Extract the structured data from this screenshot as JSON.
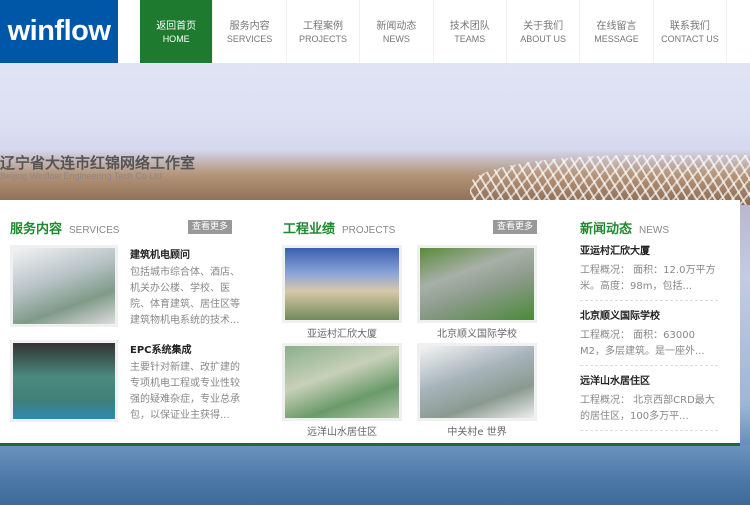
{
  "header": {
    "logo": "winflow",
    "nav": [
      {
        "cn": "返回首页",
        "en": "HOME",
        "active": true
      },
      {
        "cn": "服务内容",
        "en": "SERVICES"
      },
      {
        "cn": "工程案例",
        "en": "PROJECTS"
      },
      {
        "cn": "新闻动态",
        "en": "NEWS"
      },
      {
        "cn": "技术团队",
        "en": "TEAMS"
      },
      {
        "cn": "关于我们",
        "en": "ABOUT US"
      },
      {
        "cn": "在线留言",
        "en": "MESSAGE"
      },
      {
        "cn": "联系我们",
        "en": "CONTACT US"
      }
    ]
  },
  "banner": {
    "title": "辽宁省大连市红锦网络工作室",
    "subtitle": "Beijing Winflow Engineering Tech Co Ltd"
  },
  "services": {
    "title_cn": "服务内容",
    "title_en": "SERVICES",
    "more": "查看更多",
    "items": [
      {
        "title": "建筑机电顾问",
        "desc": "包括城市综合体、酒店、机关办公楼、学校、医院、体育建筑、居住区等建筑物机电系统的技术..."
      },
      {
        "title": "EPC系统集成",
        "desc": "主要针对新建、改扩建的专项机电工程或专业性较强的疑难杂症，专业总承包，以保证业主获得..."
      }
    ]
  },
  "projects": {
    "title_cn": "工程业绩",
    "title_en": "PROJECTS",
    "more": "查看更多",
    "items": [
      {
        "caption": "亚运村汇欣大厦"
      },
      {
        "caption": "北京顺义国际学校"
      },
      {
        "caption": "远洋山水居住区"
      },
      {
        "caption": "中关村e 世界"
      }
    ]
  },
  "news": {
    "title_cn": "新闻动态",
    "title_en": "NEWS",
    "items": [
      {
        "title": "亚运村汇欣大厦",
        "desc": "工程概况： 面积：12.0万平方米。高度：98m，包括..."
      },
      {
        "title": "北京顺义国际学校",
        "desc": "工程概况： 面积：63000 M2，多层建筑。是一座外..."
      },
      {
        "title": "远洋山水居住区",
        "desc": "工程概况： 北京西部CRD最大的居住区，100多万平..."
      }
    ]
  },
  "colors": {
    "brand": "#0057a8",
    "accent": "#1e7a2e"
  }
}
